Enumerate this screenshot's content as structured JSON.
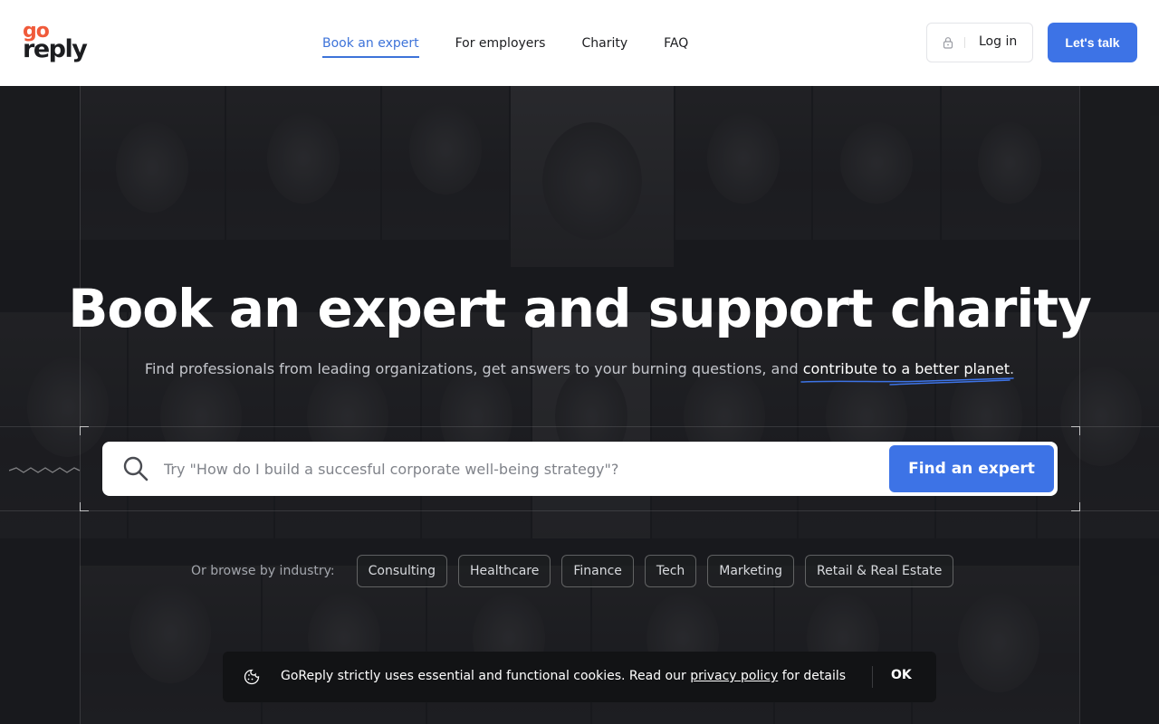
{
  "brand": {
    "logo_top": "go",
    "logo_bottom": "reply",
    "primary_color": "#3d73e6",
    "logo_accent": "#f05a3a"
  },
  "nav": {
    "items": [
      {
        "label": "Book an expert",
        "active": true
      },
      {
        "label": "For employers"
      },
      {
        "label": "Charity"
      },
      {
        "label": "FAQ"
      }
    ]
  },
  "header": {
    "login_label": "Log in",
    "talk_label": "Let's talk"
  },
  "hero": {
    "title": "Book an expert and support charity",
    "subtitle_start": "Find professionals from leading organizations, get answers to your burning questions, and ",
    "subtitle_highlight": "contribute to a better planet",
    "subtitle_end": "."
  },
  "search": {
    "placeholder": "Try \"How do I build a succesful corporate well-being strategy\"?",
    "button_label": "Find an expert"
  },
  "browse": {
    "label": "Or browse by industry:",
    "industries": [
      "Consulting",
      "Healthcare",
      "Finance",
      "Tech",
      "Marketing",
      "Retail & Real Estate"
    ]
  },
  "cookie": {
    "text_start": "GoReply strictly uses essential and functional cookies. Read our ",
    "link_label": "privacy policy",
    "text_end": " for details",
    "ok_label": "OK"
  }
}
